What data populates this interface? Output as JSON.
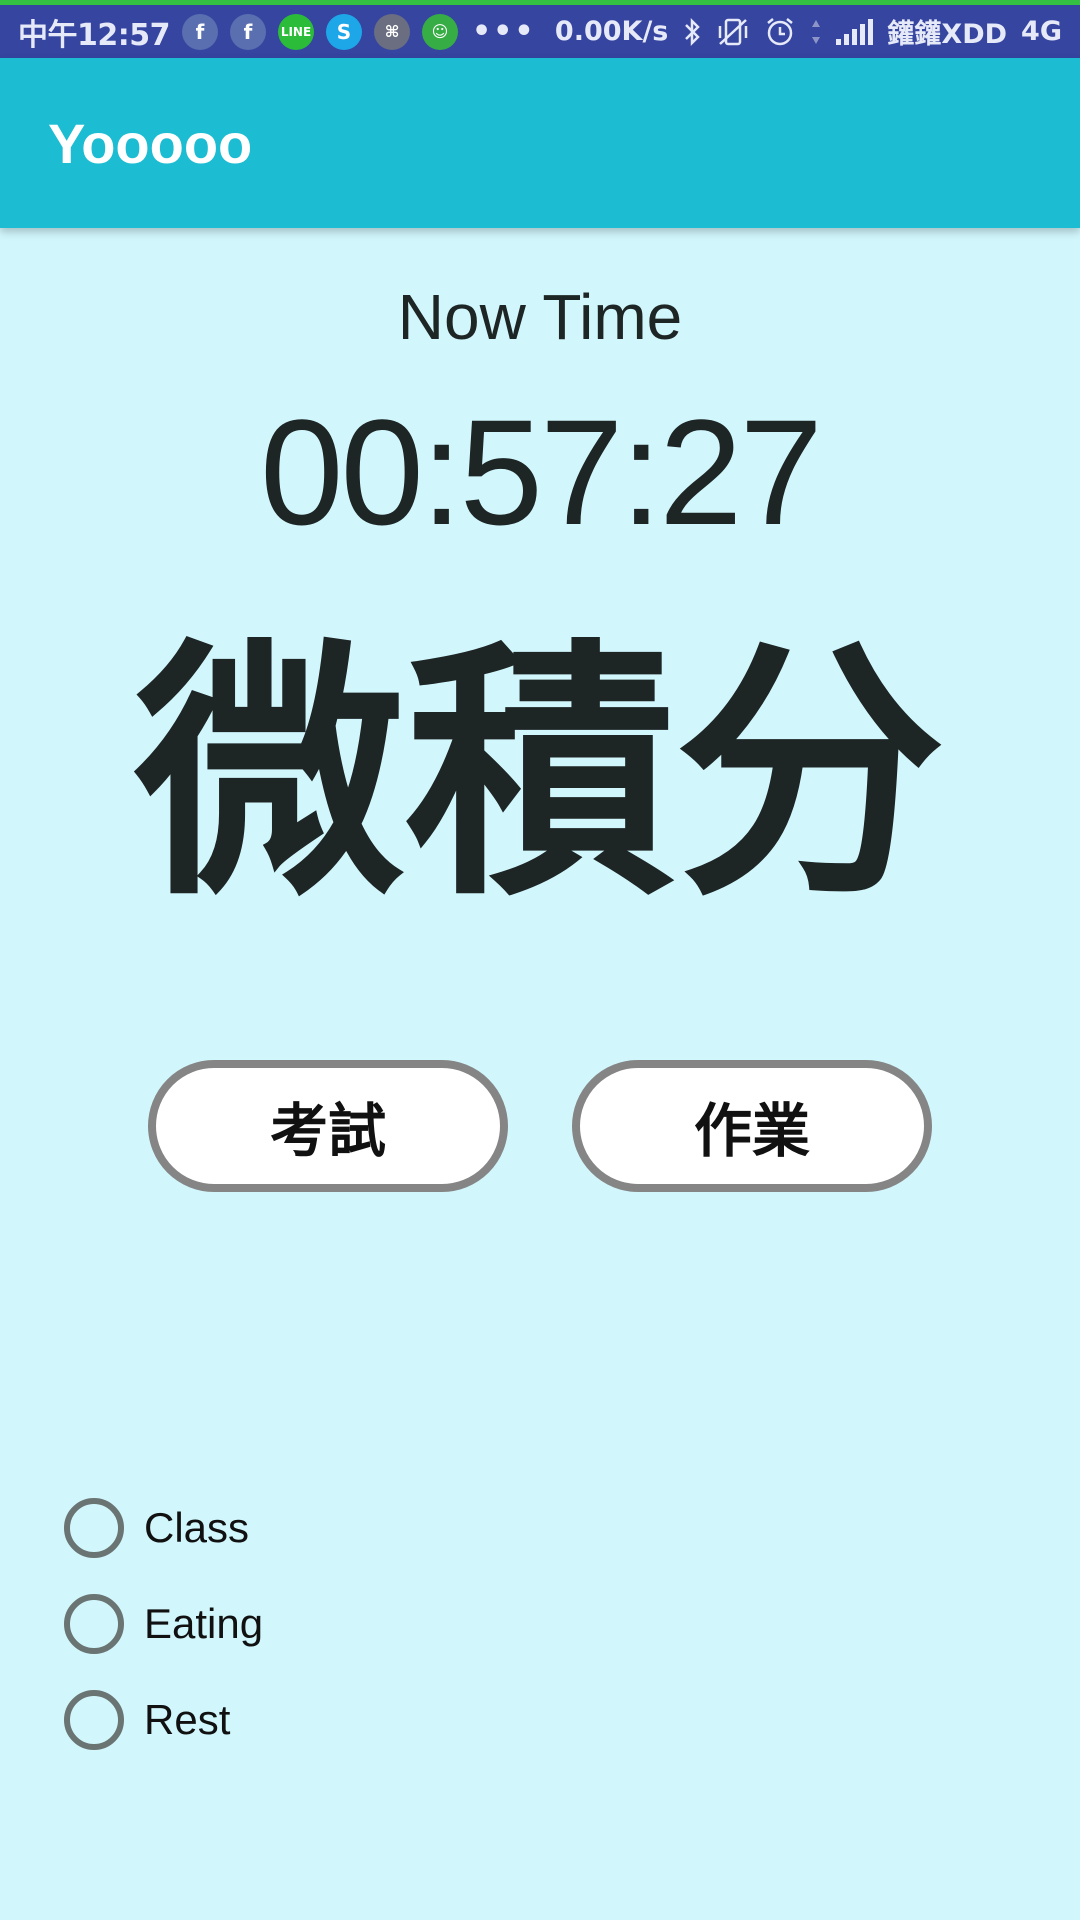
{
  "status_bar": {
    "time": "中午12:57",
    "notification_icons": [
      {
        "name": "facebook-icon",
        "glyph": "f"
      },
      {
        "name": "facebook-icon",
        "glyph": "f"
      },
      {
        "name": "line-icon",
        "glyph": "LINE"
      },
      {
        "name": "skype-icon",
        "glyph": "S"
      },
      {
        "name": "app-icon",
        "glyph": "⌘"
      },
      {
        "name": "frog-icon",
        "glyph": "☺"
      }
    ],
    "more": "•••",
    "net_speed": "0.00K/s",
    "carrier": "鑵鑵XDD",
    "network_type": "4G",
    "bg_color": "#3545a0",
    "accent_line_color": "#33c043"
  },
  "app_bar": {
    "title": "Yooooo",
    "bg_color": "#1cbcd2"
  },
  "main": {
    "now_label": "Now Time",
    "clock": "00:57:27",
    "subject": "微積分",
    "bg_color": "#d1f7fd"
  },
  "buttons": {
    "exam": "考試",
    "homework": "作業"
  },
  "radio_options": [
    {
      "label": "Class",
      "checked": false
    },
    {
      "label": "Eating",
      "checked": false
    },
    {
      "label": "Rest",
      "checked": false
    }
  ]
}
